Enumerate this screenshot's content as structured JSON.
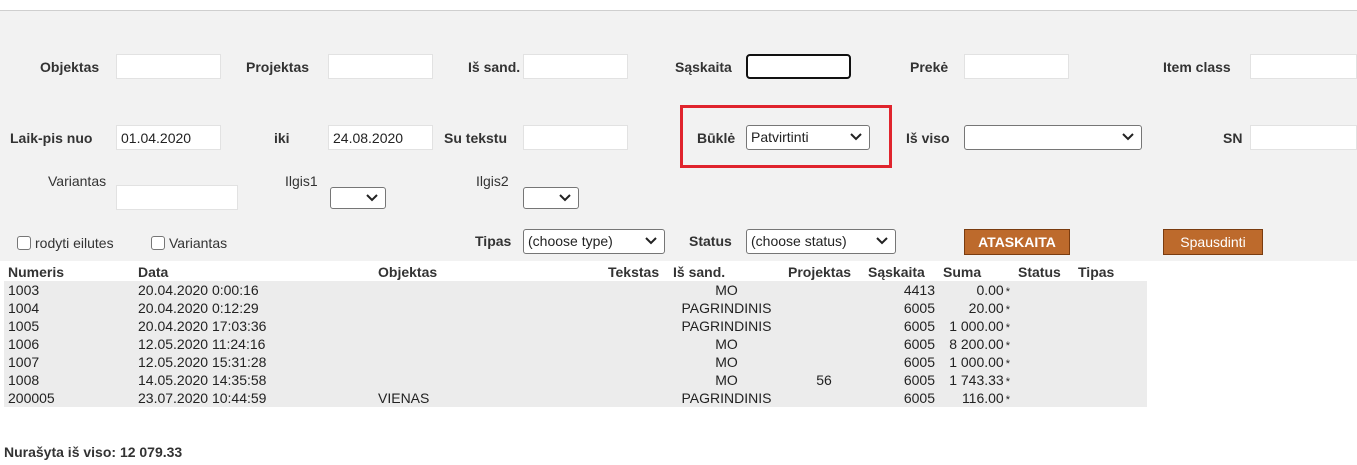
{
  "filters": {
    "objektas_label": "Objektas",
    "objektas_value": "",
    "projektas_label": "Projektas",
    "projektas_value": "",
    "is_sand_label": "Iš sand.",
    "is_sand_value": "",
    "saskaita_label": "Sąskaita",
    "saskaita_value": "",
    "preke_label": "Prekė",
    "preke_value": "",
    "item_class_label": "Item class",
    "item_class_value": "",
    "laikpis_label": "Laik-pis nuo",
    "laikpis_value": "01.04.2020",
    "iki_label": "iki",
    "iki_value": "24.08.2020",
    "su_tekstu_label": "Su tekstu",
    "su_tekstu_value": "",
    "bukle_label": "Būklė",
    "bukle_value": "Patvirtinti",
    "is_viso_label": "Iš viso",
    "is_viso_value": "",
    "sn_label": "SN",
    "sn_value": "",
    "variantas_label": "Variantas",
    "variantas_value": "",
    "ilgis1_label": "Ilgis1",
    "ilgis1_value": "",
    "ilgis2_label": "Ilgis2",
    "ilgis2_value": "",
    "rodyti_label": "rodyti eilutes",
    "variantas_chk_label": "Variantas",
    "tipas_label": "Tipas",
    "tipas_value": "(choose type)",
    "status_label": "Status",
    "status_value": "(choose status)"
  },
  "buttons": {
    "ataskaita": "ATASKAITA",
    "spausdinti": "Spausdinti"
  },
  "table": {
    "headers": {
      "numeris": "Numeris",
      "data": "Data",
      "objektas": "Objektas",
      "tekstas": "Tekstas",
      "is_sand": "Iš sand.",
      "projektas": "Projektas",
      "saskaita": "Sąskaita",
      "suma": "Suma",
      "status": "Status",
      "tipas": "Tipas"
    },
    "rows": [
      {
        "numeris": "1003",
        "data": "20.04.2020 0:00:16",
        "objektas": "",
        "tekstas": "",
        "is_sand": "MO",
        "projektas": "",
        "saskaita": "4413",
        "suma": "0.00",
        "mark": "*",
        "status": "",
        "tipas": ""
      },
      {
        "numeris": "1004",
        "data": "20.04.2020 0:12:29",
        "objektas": "",
        "tekstas": "",
        "is_sand": "PAGRINDINIS",
        "projektas": "",
        "saskaita": "6005",
        "suma": "20.00",
        "mark": "*",
        "status": "",
        "tipas": ""
      },
      {
        "numeris": "1005",
        "data": "20.04.2020 17:03:36",
        "objektas": "",
        "tekstas": "",
        "is_sand": "PAGRINDINIS",
        "projektas": "",
        "saskaita": "6005",
        "suma": "1 000.00",
        "mark": "*",
        "status": "",
        "tipas": ""
      },
      {
        "numeris": "1006",
        "data": "12.05.2020 11:24:16",
        "objektas": "",
        "tekstas": "",
        "is_sand": "MO",
        "projektas": "",
        "saskaita": "6005",
        "suma": "8 200.00",
        "mark": "*",
        "status": "",
        "tipas": ""
      },
      {
        "numeris": "1007",
        "data": "12.05.2020 15:31:28",
        "objektas": "",
        "tekstas": "",
        "is_sand": "MO",
        "projektas": "",
        "saskaita": "6005",
        "suma": "1 000.00",
        "mark": "*",
        "status": "",
        "tipas": ""
      },
      {
        "numeris": "1008",
        "data": "14.05.2020 14:35:58",
        "objektas": "",
        "tekstas": "",
        "is_sand": "MO",
        "projektas": "56",
        "saskaita": "6005",
        "suma": "1 743.33",
        "mark": "*",
        "status": "",
        "tipas": ""
      },
      {
        "numeris": "200005",
        "data": "23.07.2020 10:44:59",
        "objektas": "VIENAS",
        "tekstas": "",
        "is_sand": "PAGRINDINIS",
        "projektas": "",
        "saskaita": "6005",
        "suma": "116.00",
        "mark": "*",
        "status": "",
        "tipas": ""
      }
    ]
  },
  "footer": {
    "total_text": "Nurašyta iš viso: 12 079.33"
  },
  "colors": {
    "highlight": "#e0242d",
    "button": "#bd6a2c",
    "link": "#b5733a",
    "filter_bg": "#f2f2f2"
  }
}
